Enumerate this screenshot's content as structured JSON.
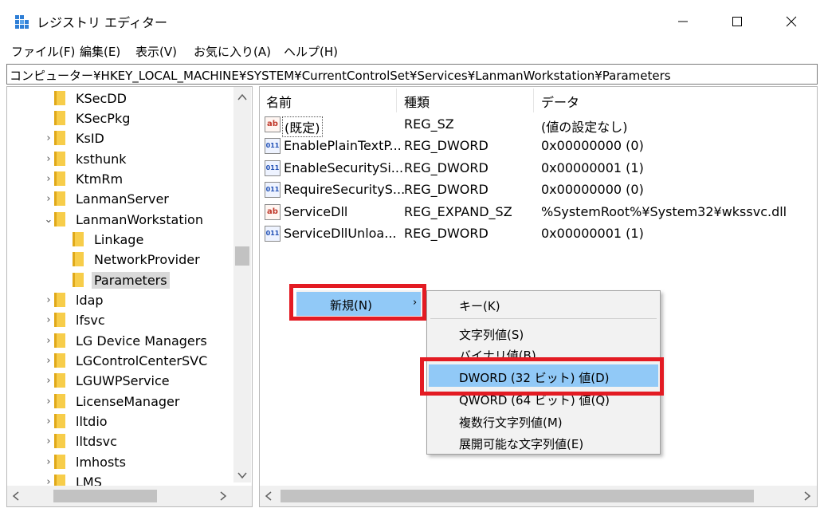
{
  "window": {
    "title": "レジストリ エディター",
    "minimize": "—",
    "maximize": "☐",
    "close": "✕"
  },
  "menu": [
    "ファイル(F)",
    "編集(E)",
    "表示(V)",
    "お気に入り(A)",
    "ヘルプ(H)"
  ],
  "address": "コンピューター¥HKEY_LOCAL_MACHINE¥SYSTEM¥CurrentControlSet¥Services¥LanmanWorkstation¥Parameters",
  "tree": [
    {
      "label": "KSecDD",
      "chev": ""
    },
    {
      "label": "KSecPkg",
      "chev": ""
    },
    {
      "label": "KsID",
      "chev": "›"
    },
    {
      "label": "ksthunk",
      "chev": "›"
    },
    {
      "label": "KtmRm",
      "chev": "›"
    },
    {
      "label": "LanmanServer",
      "chev": "›"
    },
    {
      "label": "LanmanWorkstation",
      "chev": "⌄"
    },
    {
      "label": "Linkage",
      "chev": ""
    },
    {
      "label": "NetworkProvider",
      "chev": ""
    },
    {
      "label": "Parameters",
      "chev": ""
    },
    {
      "label": "ldap",
      "chev": "›"
    },
    {
      "label": "lfsvc",
      "chev": "›"
    },
    {
      "label": "LG Device Managers",
      "chev": "›"
    },
    {
      "label": "LGControlCenterSVC",
      "chev": "›"
    },
    {
      "label": "LGUWPService",
      "chev": "›"
    },
    {
      "label": "LicenseManager",
      "chev": "›"
    },
    {
      "label": "lltdio",
      "chev": "›"
    },
    {
      "label": "lltdsvc",
      "chev": "›"
    },
    {
      "label": "lmhosts",
      "chev": "›"
    },
    {
      "label": "LMS",
      "chev": "›"
    }
  ],
  "list": {
    "headers": [
      "名前",
      "種類",
      "データ"
    ],
    "rows": [
      {
        "icon": "ab",
        "name": "(既定)",
        "type": "REG_SZ",
        "data": "(値の設定なし)"
      },
      {
        "icon": "bin",
        "name": "EnablePlainTextP...",
        "type": "REG_DWORD",
        "data": "0x00000000 (0)"
      },
      {
        "icon": "bin",
        "name": "EnableSecuritySi...",
        "type": "REG_DWORD",
        "data": "0x00000001 (1)"
      },
      {
        "icon": "bin",
        "name": "RequireSecurityS...",
        "type": "REG_DWORD",
        "data": "0x00000000 (0)"
      },
      {
        "icon": "ab",
        "name": "ServiceDll",
        "type": "REG_EXPAND_SZ",
        "data": "%SystemRoot%¥System32¥wkssvc.dll"
      },
      {
        "icon": "bin",
        "name": "ServiceDllUnloa...",
        "type": "REG_DWORD",
        "data": "0x00000001 (1)"
      }
    ]
  },
  "context_menu": {
    "new_label": "新規(N)",
    "new_arrow": "›",
    "submenu": [
      "キー(K)",
      "文字列値(S)",
      "バイナリ値(B)",
      "DWORD (32 ビット) 値(D)",
      "QWORD (64 ビット) 値(Q)",
      "複数行文字列値(M)",
      "展開可能な文字列値(E)"
    ]
  },
  "colors": {
    "highlight_border": "#e31b23",
    "menu_hover": "#91c9f7",
    "folder": "#f7cd4a"
  }
}
